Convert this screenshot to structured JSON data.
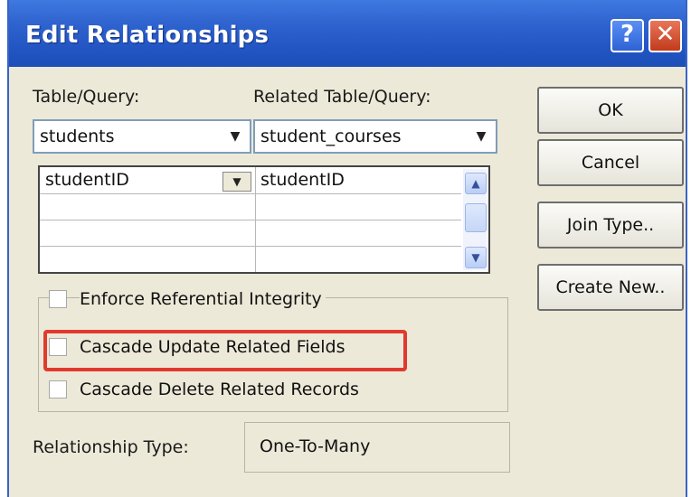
{
  "window": {
    "title": "Edit Relationships",
    "help_glyph": "?",
    "close_glyph": "✕"
  },
  "table_query": {
    "label": "Table/Query:",
    "value": "students"
  },
  "related_table_query": {
    "label": "Related Table/Query:",
    "value": "student_courses"
  },
  "field_grid": {
    "rows": [
      {
        "left": "studentID",
        "right": "studentID"
      },
      {
        "left": "",
        "right": ""
      },
      {
        "left": "",
        "right": ""
      },
      {
        "left": "",
        "right": ""
      }
    ]
  },
  "buttons": {
    "ok": "OK",
    "cancel": "Cancel",
    "join_type": "Join Type..",
    "create_new": "Create New.."
  },
  "options": {
    "enforce_referential_integrity": {
      "label": "Enforce Referential Integrity",
      "checked": false
    },
    "cascade_update": {
      "label": "Cascade Update Related Fields",
      "checked": false
    },
    "cascade_delete": {
      "label": "Cascade Delete Related Records",
      "checked": false
    }
  },
  "relationship_type": {
    "label": "Relationship Type:",
    "value": "One-To-Many"
  },
  "colors": {
    "titlebar": "#2356c4",
    "dialog_bg": "#ece9d8",
    "highlight": "#e03a2e"
  },
  "icons": {
    "dropdown": "▼",
    "scroll_up": "▲",
    "scroll_down": "▼"
  }
}
